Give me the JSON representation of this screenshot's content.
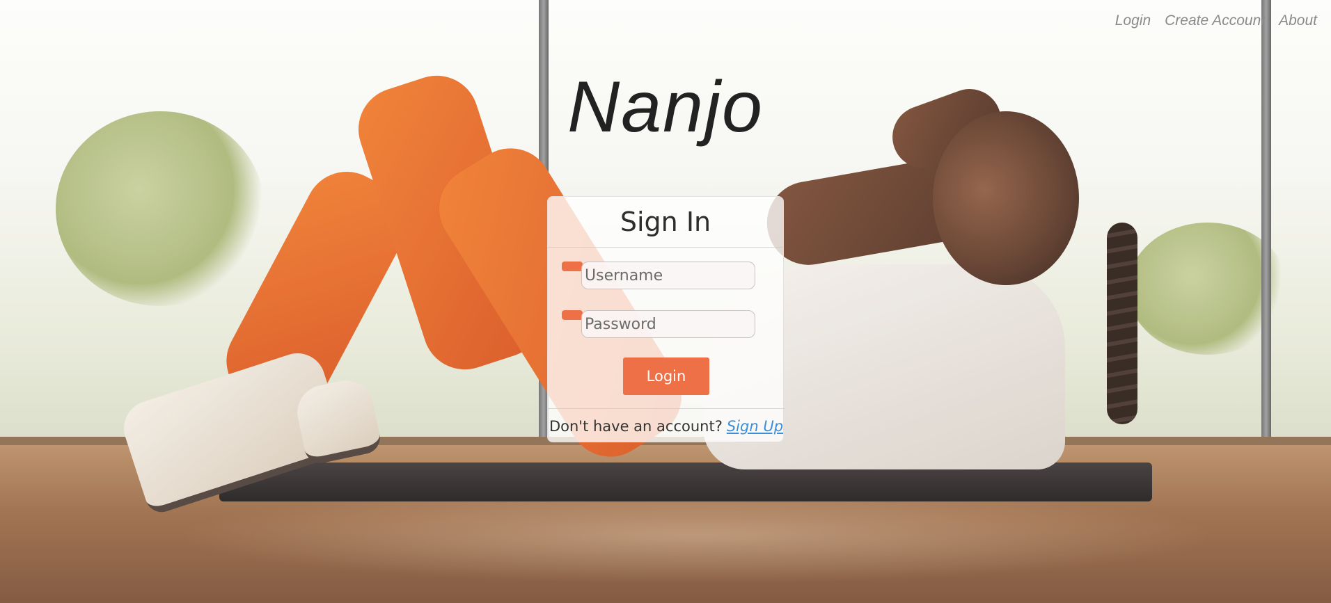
{
  "nav": {
    "login": "Login",
    "create_account": "Create Account",
    "about": "About"
  },
  "brand": {
    "title": "Nanjo"
  },
  "signin": {
    "title": "Sign In",
    "username_placeholder": "Username",
    "password_placeholder": "Password",
    "login_button": "Login",
    "footer_text": "Don't have an account?",
    "signup_link": "Sign Up"
  },
  "colors": {
    "accent": "#ee7046",
    "link": "#3b8fd8",
    "nav_text": "#8a8a8a"
  },
  "icons": {
    "username": "user-icon",
    "password": "lock-icon"
  }
}
